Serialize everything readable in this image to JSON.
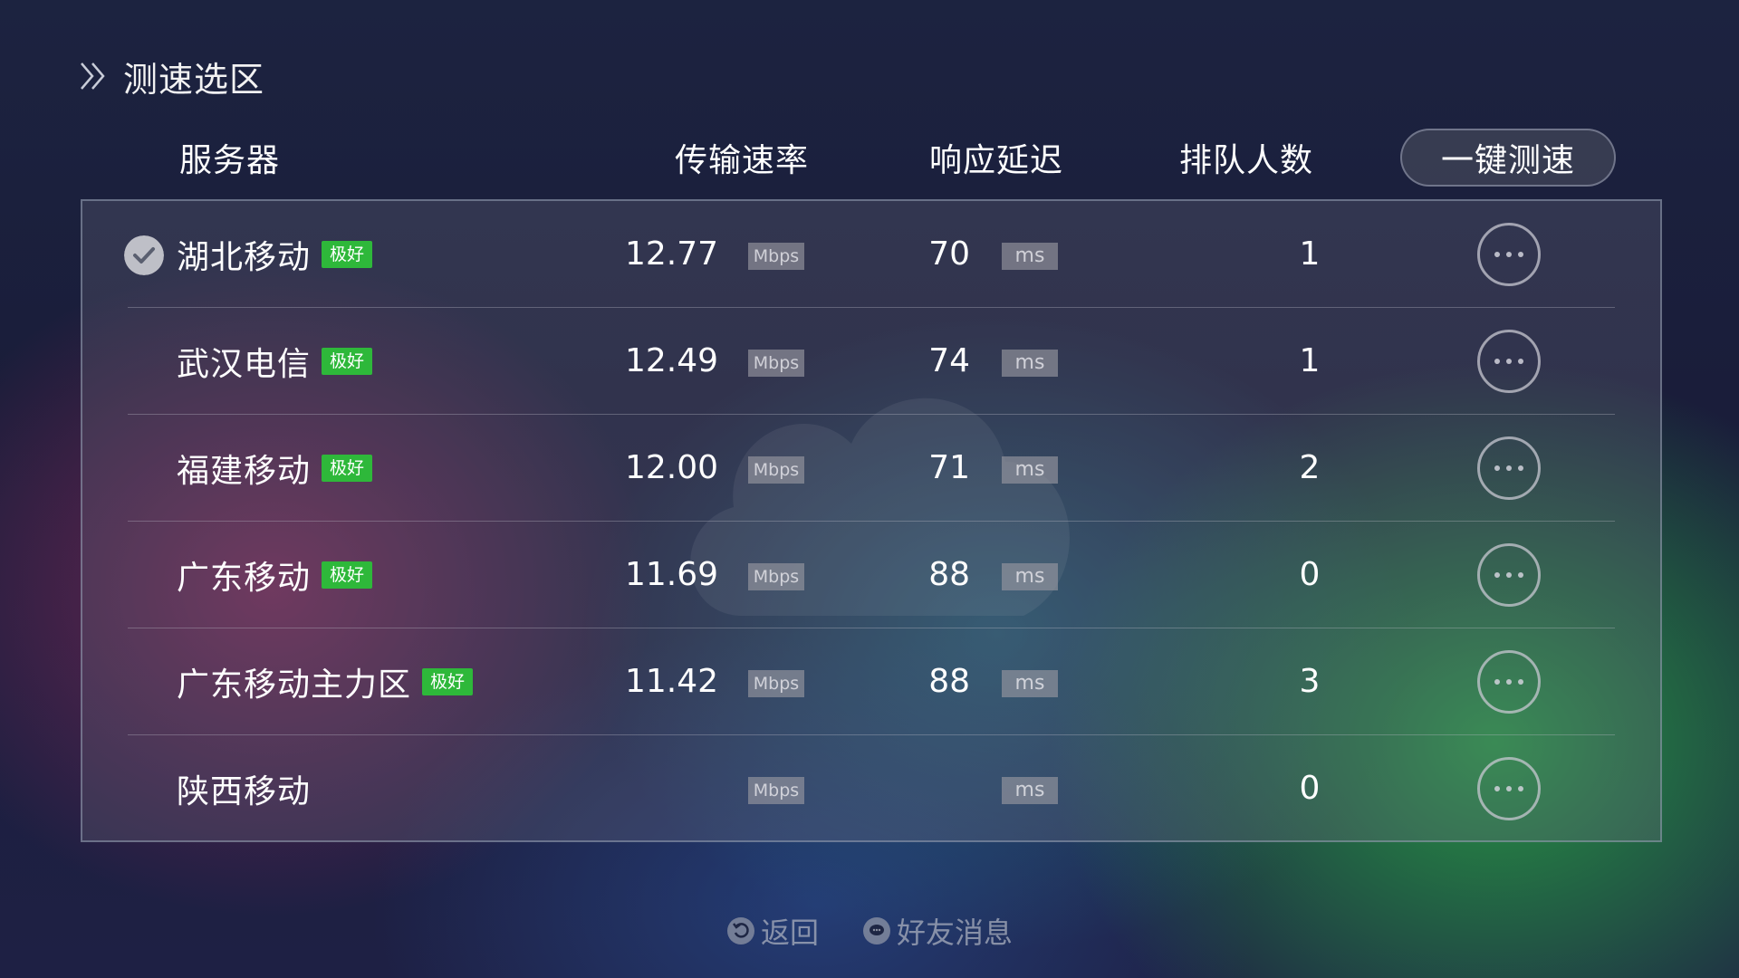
{
  "header": {
    "title": "测速选区"
  },
  "columns": {
    "server": "服务器",
    "speed": "传输速率",
    "latency": "响应延迟",
    "queue": "排队人数"
  },
  "speedtest_button": {
    "label": "一键测速"
  },
  "rows": [
    {
      "name": "湖北移动",
      "badge": "极好",
      "speed": "12.77",
      "speed_unit": "Mbps",
      "latency": "70",
      "latency_unit": "ms",
      "queue": "1",
      "selected": true
    },
    {
      "name": "武汉电信",
      "badge": "极好",
      "speed": "12.49",
      "speed_unit": "Mbps",
      "latency": "74",
      "latency_unit": "ms",
      "queue": "1",
      "selected": false
    },
    {
      "name": "福建移动",
      "badge": "极好",
      "speed": "12.00",
      "speed_unit": "Mbps",
      "latency": "71",
      "latency_unit": "ms",
      "queue": "2",
      "selected": false
    },
    {
      "name": "广东移动",
      "badge": "极好",
      "speed": "11.69",
      "speed_unit": "Mbps",
      "latency": "88",
      "latency_unit": "ms",
      "queue": "0",
      "selected": false
    },
    {
      "name": "广东移动主力区",
      "badge": "极好",
      "speed": "11.42",
      "speed_unit": "Mbps",
      "latency": "88",
      "latency_unit": "ms",
      "queue": "3",
      "selected": false
    },
    {
      "name": "陕西移动",
      "badge": "",
      "speed": "",
      "speed_unit": "Mbps",
      "latency": "",
      "latency_unit": "ms",
      "queue": "0",
      "selected": false
    }
  ],
  "footer": {
    "back_label": "返回",
    "messages_label": "好友消息"
  },
  "colors": {
    "badge_green": "#2eb83a",
    "accent_green": "#2aa845"
  },
  "icons": {
    "header": "double-chevron-right-icon",
    "selected": "check-circle-icon",
    "more": "more-dots-icon",
    "back": "back-arrow-icon",
    "messages": "chat-bubble-icon"
  }
}
